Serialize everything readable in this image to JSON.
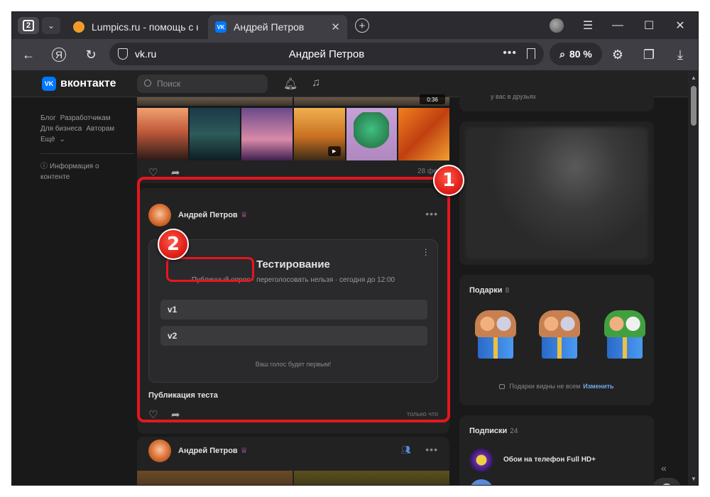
{
  "browser": {
    "tab_count": "2",
    "tabs": [
      {
        "title": "Lumpics.ru - помощь с ко"
      },
      {
        "title": "Андрей Петров"
      }
    ],
    "address": {
      "domain": "vk.ru",
      "page_title": "Андрей Петров"
    },
    "zoom": "80 %"
  },
  "vk": {
    "logo_text": "вконтакте",
    "search_placeholder": "Поиск",
    "left_links": {
      "row1": [
        "Блог",
        "Разработчикам"
      ],
      "row2": [
        "Для бизнеса",
        "Авторам"
      ],
      "more": "Ещё",
      "content_info": "Информация о контенте"
    },
    "post1": {
      "date": "28 фев",
      "video_badge": "0:36"
    },
    "post2": {
      "author": "Андрей Петров",
      "poll": {
        "title": "Тестирование",
        "meta_type": "Публичный опрос",
        "meta_rest": " · переголосовать нельзя · сегодня до 12:00",
        "options": [
          "v1",
          "v2"
        ],
        "footer": "Ваш голос будет первым!"
      },
      "text": "Публикация теста",
      "date": "только что"
    },
    "post3": {
      "author": "Андрей Петров"
    },
    "right": {
      "friends_text": "у вас в друзьях",
      "gifts_title": "Подарки",
      "gifts_count": "8",
      "gifts_note": "Подарки видны не всем",
      "gifts_change": "Изменить",
      "subs_title": "Подписки",
      "subs_count": "24",
      "subs": [
        "Обои на телефон Full HD+"
      ]
    }
  },
  "annotations": {
    "badge1": "1",
    "badge2": "2",
    "color": "#e6161e"
  }
}
